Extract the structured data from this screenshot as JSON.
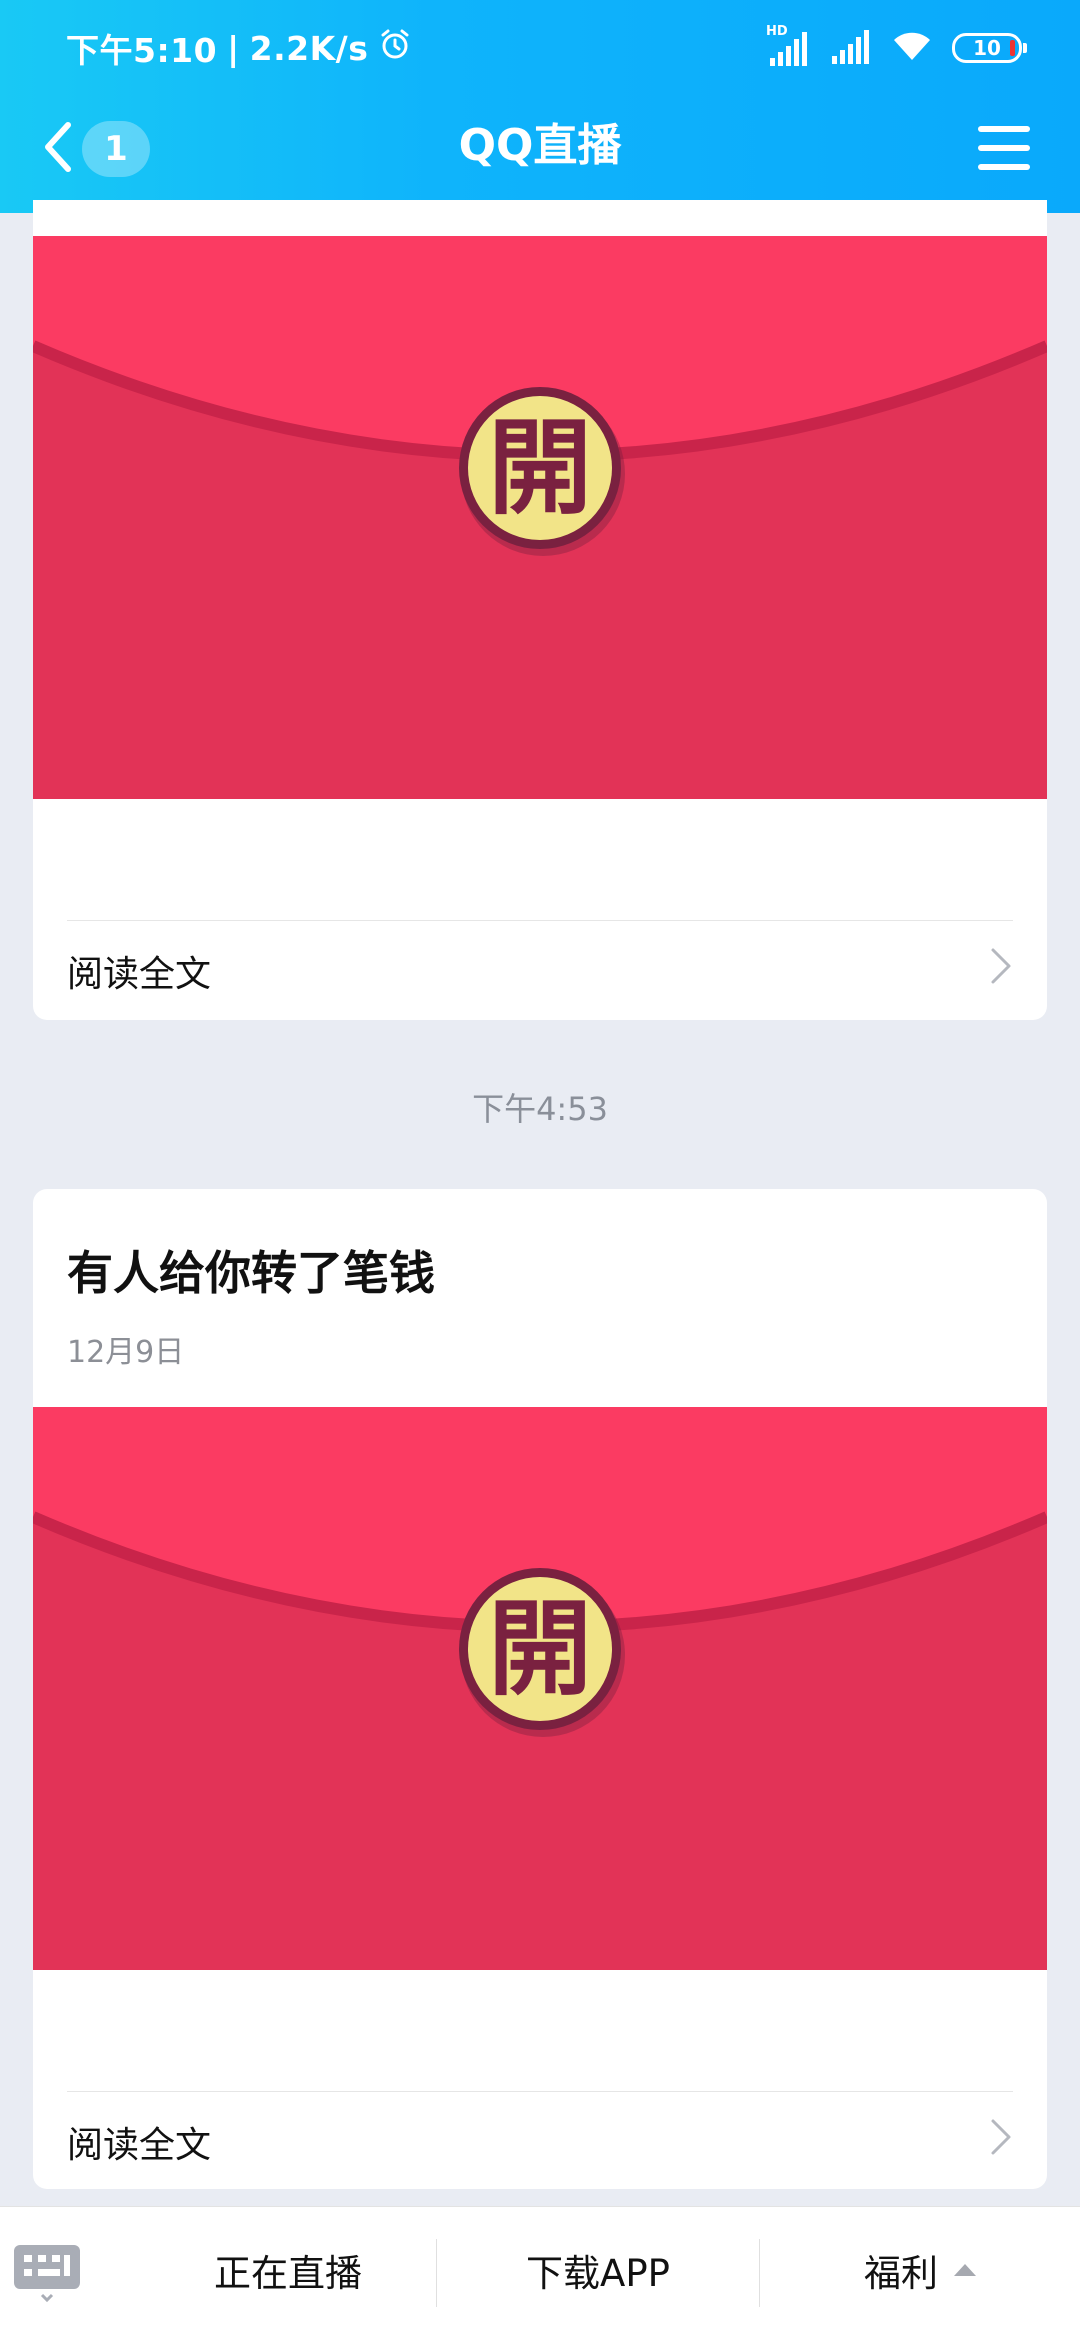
{
  "status_bar": {
    "time": "下午5:10",
    "network_speed": "2.2K/s",
    "network_type": "HD",
    "battery_level": "10",
    "icons": [
      "alarm-icon",
      "hd-signal-icon",
      "signal-icon",
      "wifi-icon",
      "battery-icon"
    ]
  },
  "nav": {
    "back_count": "1",
    "title": "QQ直播",
    "icons": [
      "chevron-left-icon",
      "menu-icon"
    ]
  },
  "feed": {
    "card1": {
      "envelope_glyph": "開",
      "read_more": "阅读全文"
    },
    "time_separator": "下午4:53",
    "card2": {
      "title": "有人给你转了笔钱",
      "date": "12月9日",
      "envelope_glyph": "開",
      "read_more": "阅读全文"
    }
  },
  "bottom_bar": {
    "tabs": [
      "正在直播",
      "下载APP",
      "福利"
    ],
    "icons": [
      "keyboard-icon",
      "triangle-up-icon"
    ]
  },
  "colors": {
    "header_start": "#19c9f5",
    "header_end": "#0aa9fb",
    "envelope_top": "#fb3b62",
    "envelope_body": "#e23357",
    "seal_gold": "#f2e488",
    "seal_ring": "#7a2140"
  }
}
